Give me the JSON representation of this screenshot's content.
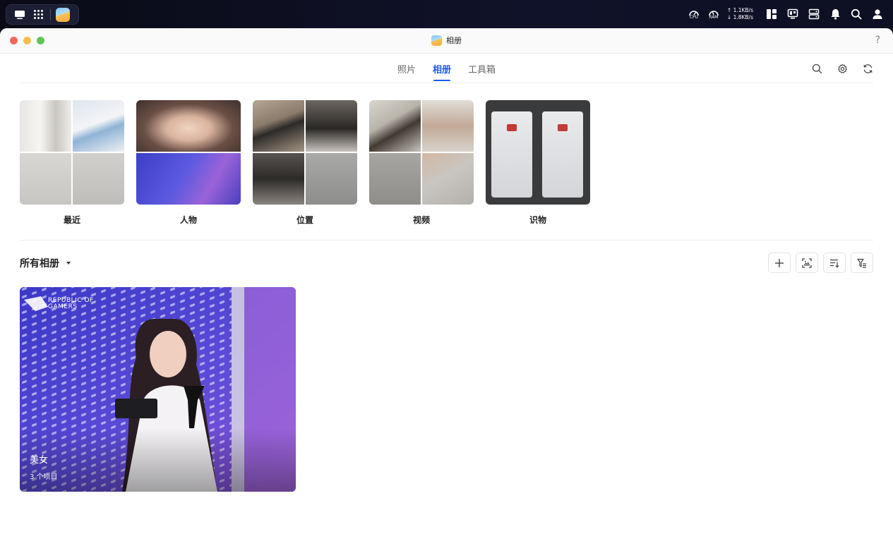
{
  "system": {
    "cpu_label": "CPU",
    "ram_label": "RAM",
    "net_up": "1.1KB/s",
    "net_down": "1.8KB/s"
  },
  "window": {
    "title": "相册",
    "help": "?"
  },
  "tabs": [
    {
      "label": "照片",
      "active": false
    },
    {
      "label": "相册",
      "active": true
    },
    {
      "label": "工具箱",
      "active": false
    }
  ],
  "categories": [
    {
      "label": "最近"
    },
    {
      "label": "人物"
    },
    {
      "label": "位置"
    },
    {
      "label": "视频"
    },
    {
      "label": "识物"
    }
  ],
  "albums_section": {
    "title": "所有相册"
  },
  "albums": [
    {
      "name": "美女",
      "count": "3 个项目",
      "logo_text_line1": "REPUBLIC OF",
      "logo_text_line2": "GAMERS"
    }
  ],
  "colors": {
    "accent": "#1a5cf0"
  }
}
